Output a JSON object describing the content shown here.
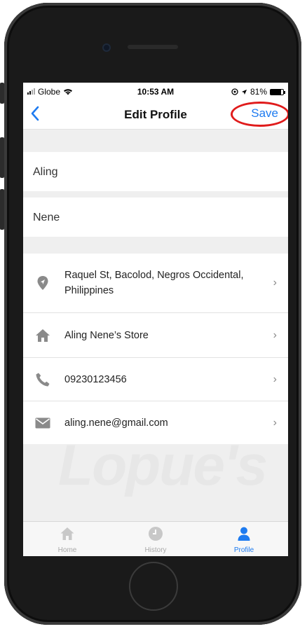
{
  "status": {
    "carrier": "Globe",
    "time": "10:53 AM",
    "battery": "81%"
  },
  "nav": {
    "title": "Edit Profile",
    "save": "Save"
  },
  "form": {
    "first_name": "Aling",
    "last_name": "Nene"
  },
  "details": [
    {
      "icon": "location-pin-icon",
      "text": "Raquel St, Bacolod, Negros Occidental, Philippines"
    },
    {
      "icon": "store-icon",
      "text": "Aling Nene’s Store"
    },
    {
      "icon": "phone-icon",
      "text": "09230123456"
    },
    {
      "icon": "email-icon",
      "text": "aling.nene@gmail.com"
    }
  ],
  "tabs": [
    {
      "label": "Home",
      "icon": "home-icon",
      "active": false
    },
    {
      "label": "History",
      "icon": "clock-icon",
      "active": false
    },
    {
      "label": "Profile",
      "icon": "profile-icon",
      "active": true
    }
  ],
  "colors": {
    "accent": "#1e7bf0",
    "highlight_ring": "#e01b1b"
  }
}
